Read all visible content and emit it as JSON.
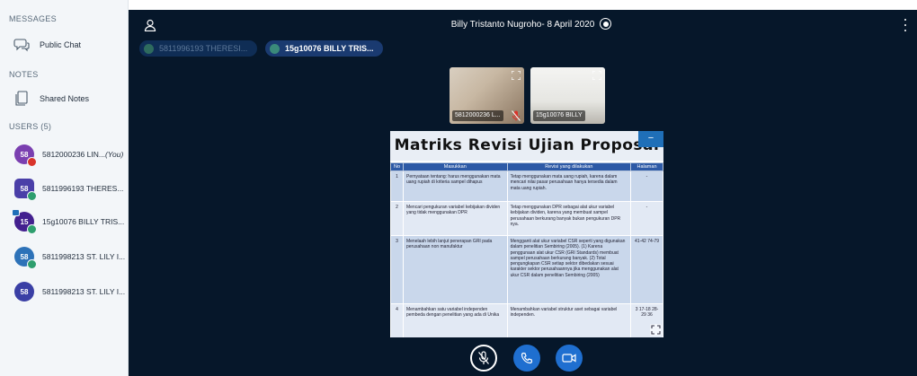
{
  "sidebar": {
    "messages_title": "MESSAGES",
    "public_chat": "Public Chat",
    "notes_title": "NOTES",
    "shared_notes": "Shared Notes",
    "users_title": "USERS (5)",
    "users": [
      {
        "initials": "58",
        "name": "5812000236 LIN...",
        "you": "(You)",
        "color": "#7a3fb0",
        "status_color": "#d9342b"
      },
      {
        "initials": "58",
        "name": "5811996193 THERES...",
        "you": "",
        "color": "#4a3fa8",
        "status_color": "#2e9e6e"
      },
      {
        "initials": "15",
        "name": "15g10076 BILLY TRIS...",
        "you": "",
        "color": "#43208f",
        "status_color": "#2e9e6e"
      },
      {
        "initials": "58",
        "name": "5811998213 ST. LILY I...",
        "you": "",
        "color": "#2d72b8",
        "status_color": "#2e9e6e"
      },
      {
        "initials": "58",
        "name": "5811998213 ST. LILY I...",
        "you": "",
        "color": "#3a3fa5",
        "status_color": ""
      }
    ]
  },
  "main": {
    "title": "Billy Tristanto Nugroho- 8 April 2020",
    "talkers": [
      {
        "label": "5811996193 THERESI...",
        "dot_color": "#2e6b5e"
      },
      {
        "label": "15g10076 BILLY TRIS...",
        "dot_color": "#3a8a7a"
      }
    ],
    "webcams": [
      {
        "name": "5812000236 L..."
      },
      {
        "name": "15g10076 BILLY"
      }
    ]
  },
  "slide": {
    "title": "Matriks Revisi Ujian Proposal",
    "minimize": "−",
    "headers": [
      "No",
      "Masukkan",
      "Revisi yang dilakukan",
      "Halaman"
    ],
    "rows": [
      {
        "no": "1",
        "masukkan": "Pernyataan tentang: harus menggunakan mata uang rupiah di kriteria sampel dihapus",
        "revisi": "Tetap menggunakan mata uang rupiah, karena dalam mencari nilai pasar perusahaan hanya tersedia dalam mata uang rupiah.",
        "halaman": "-"
      },
      {
        "no": "2",
        "masukkan": "Mencari pengukuran variabel kebijakan dividen yang tidak menggunakan DPR",
        "revisi": "Tetap menggunakan DPR sebagai alat ukur variabel kebijakan dividen, karena yang membuat sampel perusahaan berkurang banyak bukan pengukuran DPR nya.",
        "halaman": "-"
      },
      {
        "no": "3",
        "masukkan": "Menelaah lebih lanjut penerapan GRI pada perusahaan non manufaktur",
        "revisi": "Mengganti alat ukur variabel CSR seperti yang digunakan dalam penelitian Sembiring (2005). (1) Karena penggunaan alat ukur CSR (GRI Standards) membuat sampel perusahaan berkurang banyak. (2) Total pengungkapan CSR setiap sektor dibedakan sesuai karakter sektor perusahaannya jika menggunakan alat ukur CSR dalam penelitian Sembiring (2005)",
        "halaman": "41-42 74-79"
      },
      {
        "no": "4",
        "masukkan": "Menambahkan satu variabel independen pembeda dengan penelitian yang ada di Unika",
        "revisi": "Menambahkan variabel struktur aset sebagai variabel independen.",
        "halaman": "3 17-18 28-29 36"
      }
    ]
  }
}
